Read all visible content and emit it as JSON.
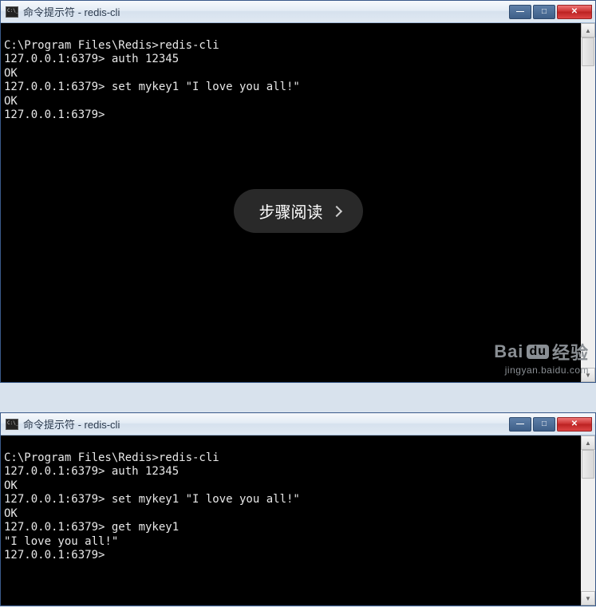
{
  "window1": {
    "title": "命令提示符 - redis-cli",
    "lines": [
      "C:\\Program Files\\Redis>redis-cli",
      "127.0.0.1:6379> auth 12345",
      "OK",
      "127.0.0.1:6379> set mykey1 \"I love you all!\"",
      "OK",
      "127.0.0.1:6379>"
    ]
  },
  "window2": {
    "title": "命令提示符 - redis-cli",
    "lines": [
      "C:\\Program Files\\Redis>redis-cli",
      "127.0.0.1:6379> auth 12345",
      "OK",
      "127.0.0.1:6379> set mykey1 \"I love you all!\"",
      "OK",
      "127.0.0.1:6379> get mykey1",
      "\"I love you all!\"",
      "127.0.0.1:6379>"
    ]
  },
  "overlay": {
    "step_label": "步骤阅读"
  },
  "watermark": {
    "brand": "Bai",
    "du": "du",
    "jy": "经验",
    "url": "jingyan.baidu.com"
  },
  "controls": {
    "min": "—",
    "max": "□",
    "close": "✕",
    "up": "▲",
    "down": "▼"
  }
}
